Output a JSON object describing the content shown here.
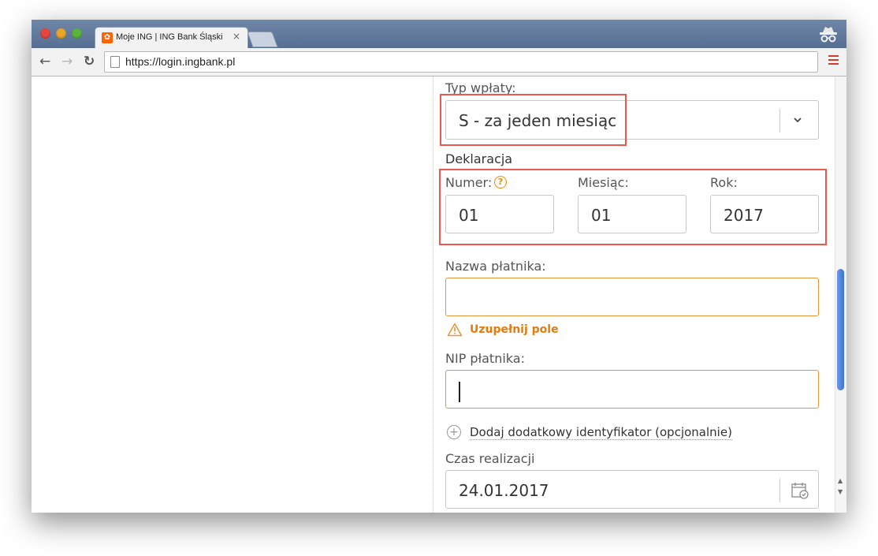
{
  "browser": {
    "tab_title": "Moje ING | ING Bank Śląski",
    "tab_close": "×",
    "url": "https://login.ingbank.pl"
  },
  "form": {
    "payment_type": {
      "label": "Typ wpłaty:",
      "value": "S - za jeden miesiąc"
    },
    "declaration": {
      "heading": "Deklaracja",
      "number_label": "Numer:",
      "number_value": "01",
      "month_label": "Miesiąc:",
      "month_value": "01",
      "year_label": "Rok:",
      "year_value": "2017"
    },
    "payer_name": {
      "label": "Nazwa płatnika:",
      "value": "",
      "error": "Uzupełnij pole"
    },
    "payer_nip": {
      "label": "NIP płatnika:",
      "value": ""
    },
    "add_identifier": "Dodaj dodatkowy identyfikator (opcjonalnie)",
    "execution_date": {
      "label": "Czas realizacji",
      "value": "24.01.2017"
    }
  },
  "colors": {
    "accent": "#ec7c1e",
    "highlight": "#e85a50",
    "titlebar": "#566f93"
  },
  "icons": [
    "back-icon",
    "forward-icon",
    "reload-icon",
    "page-icon",
    "menu-icon",
    "incognito-icon",
    "help-icon",
    "warning-icon",
    "plus-icon",
    "calendar-icon",
    "chevron-down-icon"
  ]
}
